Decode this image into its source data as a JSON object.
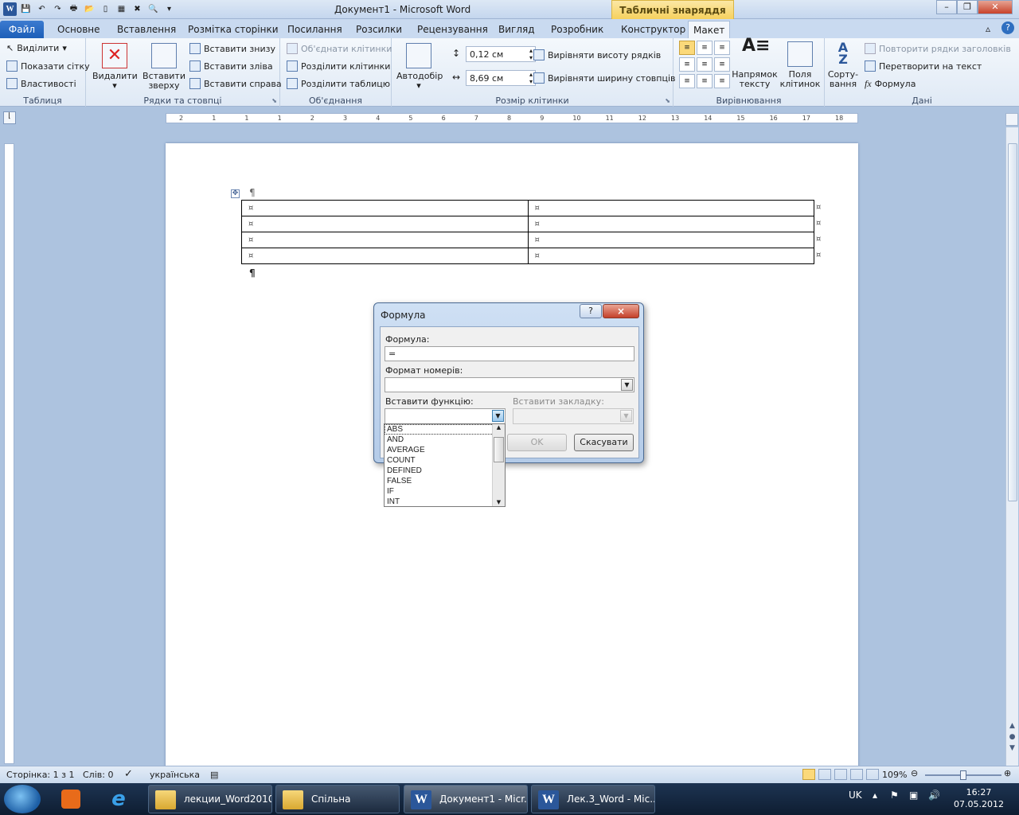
{
  "window": {
    "title": "Документ1  -  Microsoft Word",
    "contextual_tab_header": "Табличні знаряддя"
  },
  "tabs": [
    {
      "label": "Файл"
    },
    {
      "label": "Основне"
    },
    {
      "label": "Вставлення"
    },
    {
      "label": "Розмітка сторінки"
    },
    {
      "label": "Посилання"
    },
    {
      "label": "Розсилки"
    },
    {
      "label": "Рецензування"
    },
    {
      "label": "Вигляд"
    },
    {
      "label": "Розробник"
    },
    {
      "label": "Конструктор"
    },
    {
      "label": "Макет",
      "active": true
    }
  ],
  "ribbon": {
    "table_group": {
      "label": "Таблиця",
      "select": "Виділити",
      "gridlines": "Показати сітку",
      "properties": "Властивості"
    },
    "rows_cols_group": {
      "label": "Рядки та стовпці",
      "delete": "Видалити",
      "insert_above_1": "Вставити",
      "insert_above_2": "зверху",
      "insert_below": "Вставити знизу",
      "insert_left": "Вставити зліва",
      "insert_right": "Вставити справа"
    },
    "merge_group": {
      "label": "Об'єднання",
      "merge_cells": "Об'єднати клітинки",
      "split_cells": "Розділити клітинки",
      "split_table": "Розділити таблицю"
    },
    "cell_size_group": {
      "label": "Розмір клітинки",
      "autofit": "Автодобір",
      "height_value": "0,12 см",
      "width_value": "8,69 см",
      "distribute_rows": "Вирівняти висоту рядків",
      "distribute_cols": "Вирівняти ширину стовпців"
    },
    "alignment_group": {
      "label": "Вирівнювання",
      "text_direction_1": "Напрямок",
      "text_direction_2": "тексту",
      "cell_margins_1": "Поля",
      "cell_margins_2": "клітинок"
    },
    "data_group": {
      "label": "Дані",
      "sort_1": "Сорту-",
      "sort_2": "вання",
      "repeat_headers": "Повторити рядки заголовків",
      "convert_text": "Перетворити на текст",
      "formula": "Формула"
    }
  },
  "ruler": {
    "ticks": [
      "2",
      "1",
      "1",
      "1",
      "2",
      "3",
      "4",
      "5",
      "6",
      "7",
      "8",
      "9",
      "10",
      "11",
      "12",
      "13",
      "14",
      "15",
      "16",
      "17",
      "18"
    ]
  },
  "document": {
    "paragraph_mark": "¶",
    "cell_mark": "¤",
    "rows": 4,
    "cols": 2
  },
  "dialog": {
    "title": "Формула",
    "help": "?",
    "close": "×",
    "formula_label": "Формула:",
    "formula_value": "=",
    "number_format_label": "Формат номерів:",
    "number_format_value": "",
    "insert_function_label": "Вставити функцію:",
    "insert_bookmark_label": "Вставити закладку:",
    "ok": "OK",
    "cancel": "Скасувати",
    "functions": [
      "ABS",
      "AND",
      "AVERAGE",
      "COUNT",
      "DEFINED",
      "FALSE",
      "IF",
      "INT"
    ]
  },
  "statusbar": {
    "page": "Сторінка: 1 з 1",
    "words": "Слів: 0",
    "language": "українська",
    "zoom": "109%"
  },
  "taskbar": {
    "items": [
      {
        "label": "лекции_Word2010"
      },
      {
        "label": "Спільна"
      },
      {
        "label": "Документ1 - Micr..."
      },
      {
        "label": "Лек.3_Word - Mic..."
      }
    ],
    "lang": "UK",
    "time": "16:27",
    "date": "07.05.2012"
  }
}
